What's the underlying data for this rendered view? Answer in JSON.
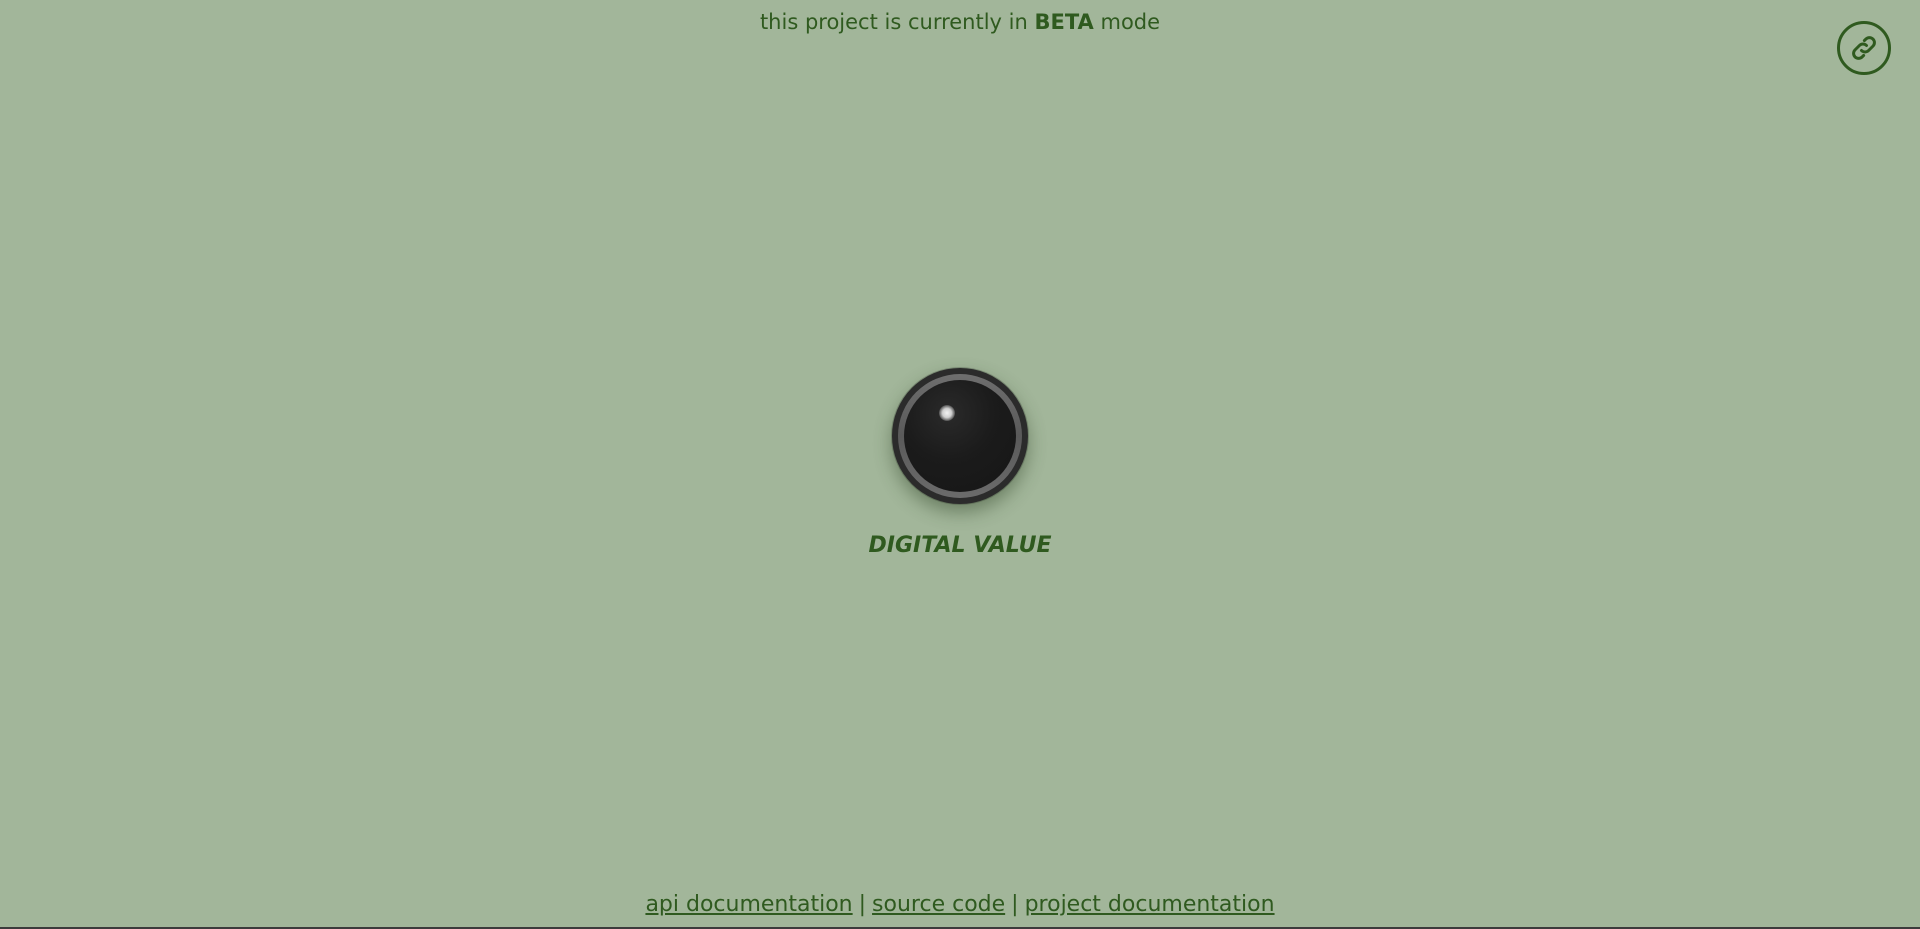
{
  "banner": {
    "prefix": "this project is currently in",
    "emphasis": "BETA",
    "suffix": "mode"
  },
  "header": {
    "link_button_icon": "link-icon"
  },
  "indicator": {
    "label": "DIGITAL VALUE",
    "state": "off"
  },
  "footer": {
    "links": [
      {
        "label": "api documentation"
      },
      {
        "label": "source code"
      },
      {
        "label": "project documentation"
      }
    ],
    "separator": "|"
  },
  "colors": {
    "background": "#a2b69a",
    "accent": "#2f5a1f"
  }
}
